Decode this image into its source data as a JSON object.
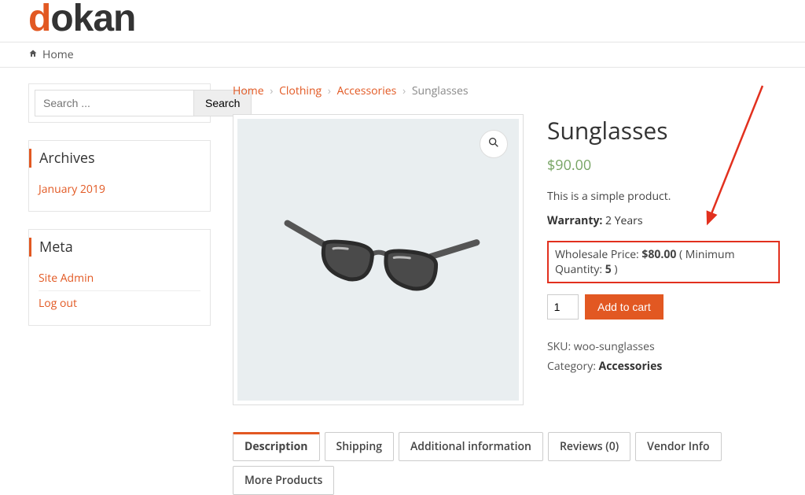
{
  "logo": {
    "first": "d",
    "rest": "okan"
  },
  "nav": {
    "home": "Home"
  },
  "search": {
    "placeholder": "Search ...",
    "button": "Search"
  },
  "archives": {
    "title": "Archives",
    "items": [
      "January 2019"
    ]
  },
  "meta_widget": {
    "title": "Meta",
    "items": [
      "Site Admin",
      "Log out"
    ]
  },
  "breadcrumb": {
    "items": [
      "Home",
      "Clothing",
      "Accessories"
    ],
    "current": "Sunglasses"
  },
  "product": {
    "title": "Sunglasses",
    "price": "$90.00",
    "short_description": "This is a simple product.",
    "warranty_label": "Warranty:",
    "warranty_value": "2 Years",
    "wholesale": {
      "label_prefix": "Wholesale Price: ",
      "price": "$80.00",
      "min_qty_prefix": " ( Minimum Quantity: ",
      "min_qty": "5",
      "suffix": " )"
    },
    "qty_value": "1",
    "add_to_cart": "Add to cart",
    "sku_label": "SKU: ",
    "sku": "woo-sunglasses",
    "category_label": "Category: ",
    "category": "Accessories"
  },
  "icons": {
    "home": "home-icon",
    "zoom": "magnifier-icon"
  },
  "tabs": [
    {
      "label": "Description",
      "active": true
    },
    {
      "label": "Shipping"
    },
    {
      "label": "Additional information"
    },
    {
      "label": "Reviews (0)"
    },
    {
      "label": "Vendor Info"
    },
    {
      "label": "More Products"
    }
  ]
}
